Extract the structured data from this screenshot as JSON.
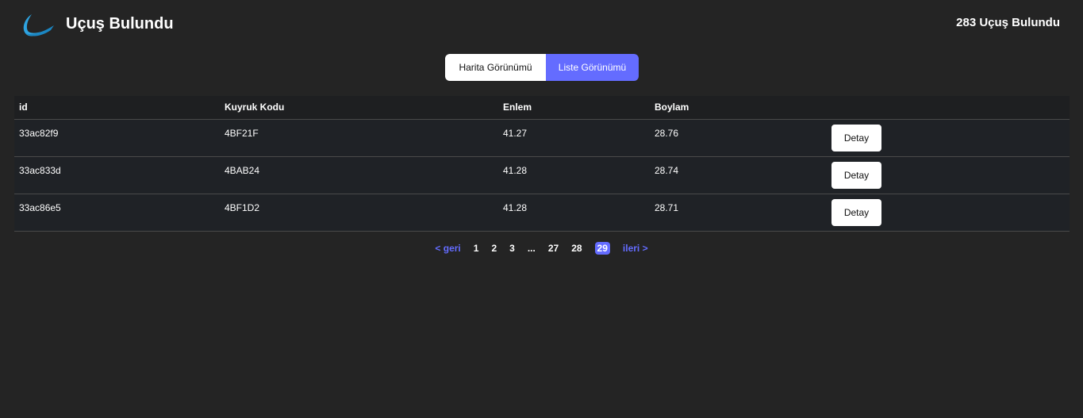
{
  "header": {
    "logo_icon": "airplane-swoosh-icon",
    "title": "Uçuş Bulundu",
    "found_count": "283 Uçuş Bulundu"
  },
  "view_toggle": {
    "map_label": "Harita Görünümü",
    "list_label": "Liste Görünümü",
    "active": "list"
  },
  "table": {
    "columns": [
      "id",
      "Kuyruk Kodu",
      "Enlem",
      "Boylam"
    ],
    "rows": [
      {
        "id": "33ac82f9",
        "tail_code": "4BF21F",
        "lat": "41.27",
        "lon": "28.76",
        "action": "Detay"
      },
      {
        "id": "33ac833d",
        "tail_code": "4BAB24",
        "lat": "41.28",
        "lon": "28.74",
        "action": "Detay"
      },
      {
        "id": "33ac86e5",
        "tail_code": "4BF1D2",
        "lat": "41.28",
        "lon": "28.71",
        "action": "Detay"
      }
    ]
  },
  "pagination": {
    "prev_label": "< geri",
    "next_label": "ileri >",
    "pages": [
      "1",
      "2",
      "3",
      "...",
      "27",
      "28",
      "29"
    ],
    "current": "29"
  },
  "colors": {
    "background": "#242424",
    "accent": "#646cff",
    "logo": "#2ea3e0"
  }
}
